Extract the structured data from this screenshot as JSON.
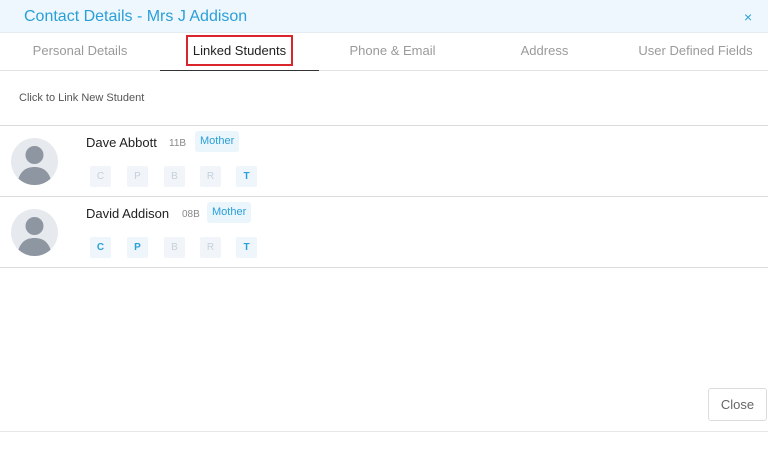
{
  "dialog": {
    "title": "Contact Details - Mrs J Addison",
    "close_glyph": "×"
  },
  "tabs": [
    {
      "label": "Personal Details",
      "active": false
    },
    {
      "label": "Linked Students",
      "active": true
    },
    {
      "label": "Phone & Email",
      "active": false
    },
    {
      "label": "Address",
      "active": false
    },
    {
      "label": "User Defined Fields",
      "active": false
    }
  ],
  "link_new_student": "Click to Link New Student",
  "students": [
    {
      "name": "Dave Abbott",
      "form": "11B",
      "relation": "Mother",
      "flags": [
        {
          "letter": "C",
          "active": false
        },
        {
          "letter": "P",
          "active": false
        },
        {
          "letter": "B",
          "active": false
        },
        {
          "letter": "R",
          "active": false
        },
        {
          "letter": "T",
          "active": true
        }
      ]
    },
    {
      "name": "David Addison",
      "form": "08B",
      "relation": "Mother",
      "flags": [
        {
          "letter": "C",
          "active": true
        },
        {
          "letter": "P",
          "active": true
        },
        {
          "letter": "B",
          "active": false
        },
        {
          "letter": "R",
          "active": false
        },
        {
          "letter": "T",
          "active": true
        }
      ]
    }
  ],
  "footer": {
    "close_label": "Close"
  },
  "colors": {
    "accent": "#2a9fd8",
    "highlight_border": "#d9262e"
  },
  "icons": {
    "avatar": "person-silhouette-icon",
    "close": "close-icon"
  }
}
